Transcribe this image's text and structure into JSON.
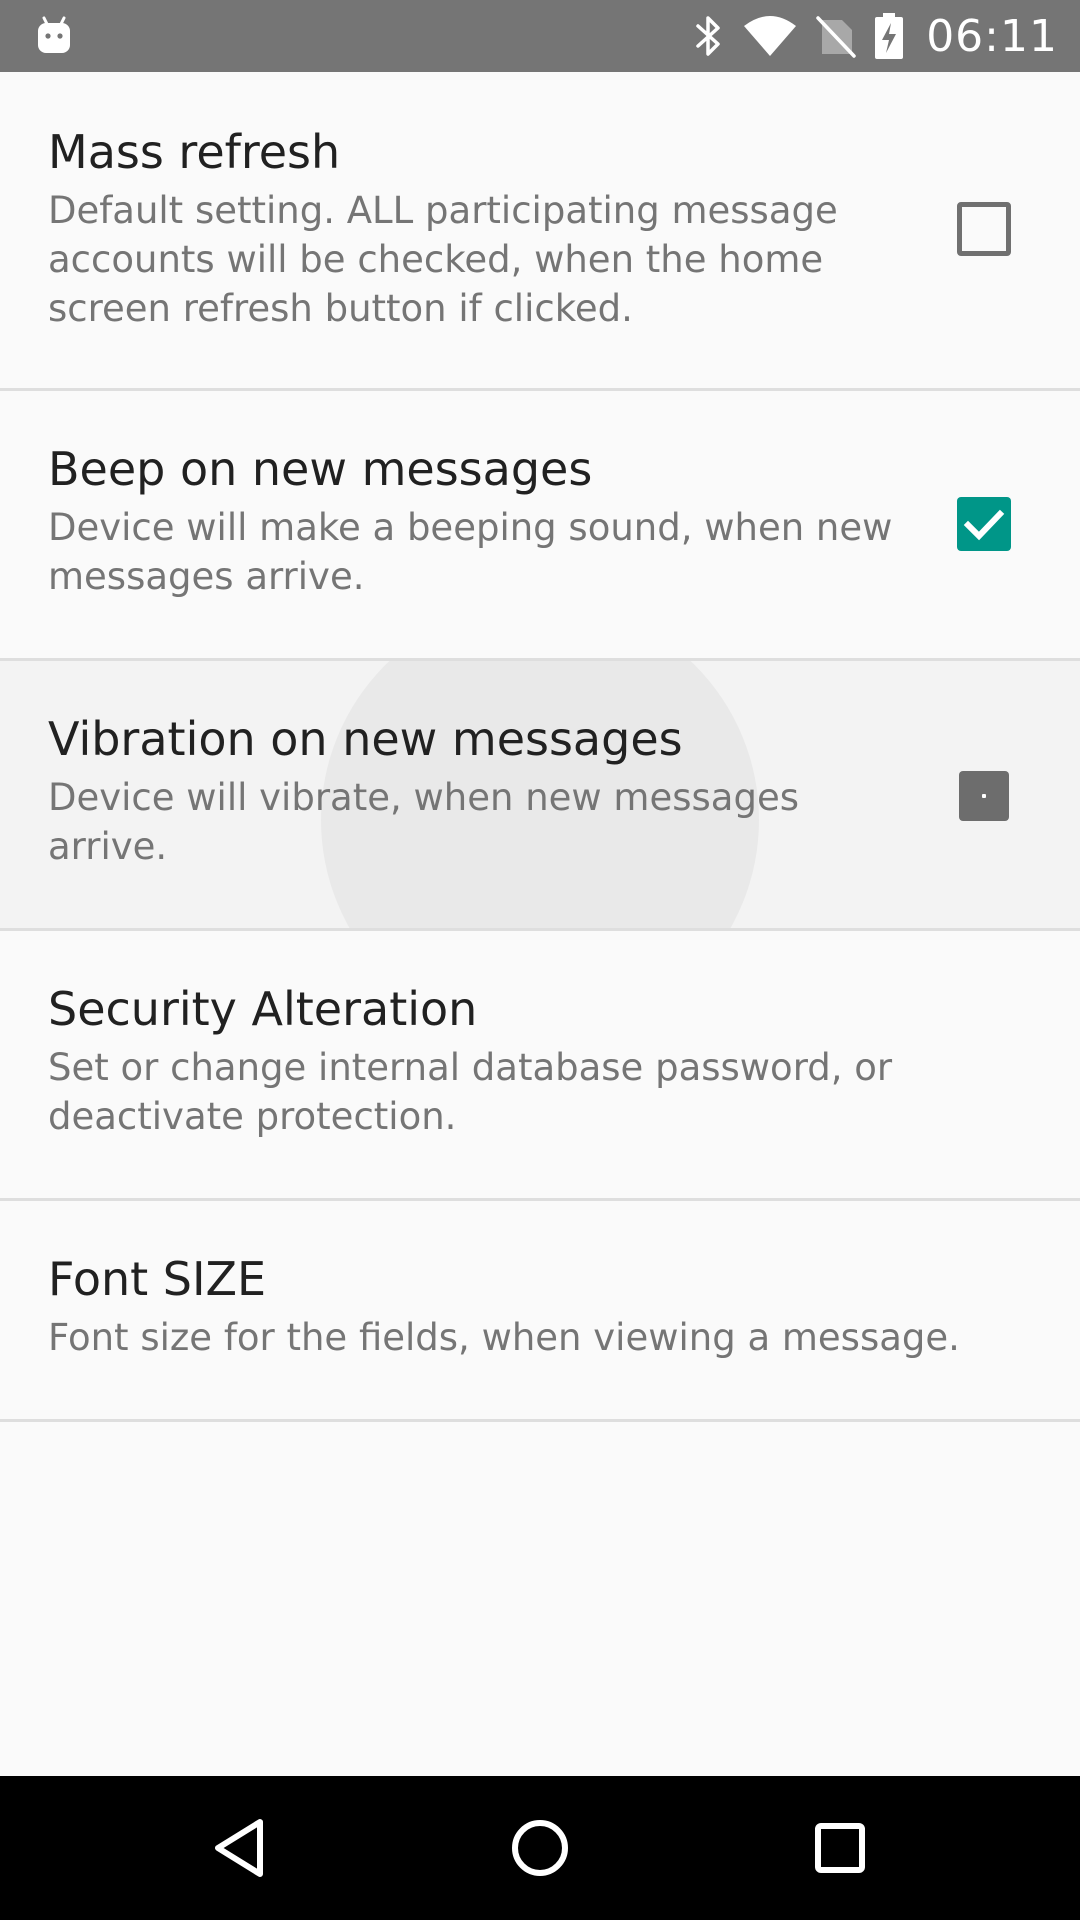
{
  "status_bar": {
    "time": "06:11",
    "icons": [
      "android-notification-icon",
      "bluetooth-icon",
      "wifi-icon",
      "no-sim-icon",
      "battery-charging-icon"
    ],
    "background_color": "#757575"
  },
  "preferences": [
    {
      "title": "Mass refresh",
      "summary": "Default setting. ALL participating message accounts will be checked, when the home screen refresh button if clicked.",
      "checkbox": "unchecked"
    },
    {
      "title": "Beep on new messages",
      "summary": "Device will make a beeping sound, when new messages arrive.",
      "checkbox": "checked"
    },
    {
      "title": "Vibration on new messages",
      "summary": "Device will vibrate, when new messages arrive.",
      "checkbox": "pressed"
    },
    {
      "title": "Security Alteration",
      "summary": "Set or change internal database password, or deactivate protection."
    },
    {
      "title": "Font SIZE",
      "summary": "Font size for the fields, when viewing a message."
    }
  ],
  "nav_bar": {
    "icons": [
      "back-icon",
      "home-icon",
      "recents-icon"
    ]
  },
  "colors": {
    "accent": "#009688",
    "title_text": "#212121",
    "summary_text": "#757575",
    "divider": "#dedede",
    "background": "#fafafa"
  }
}
